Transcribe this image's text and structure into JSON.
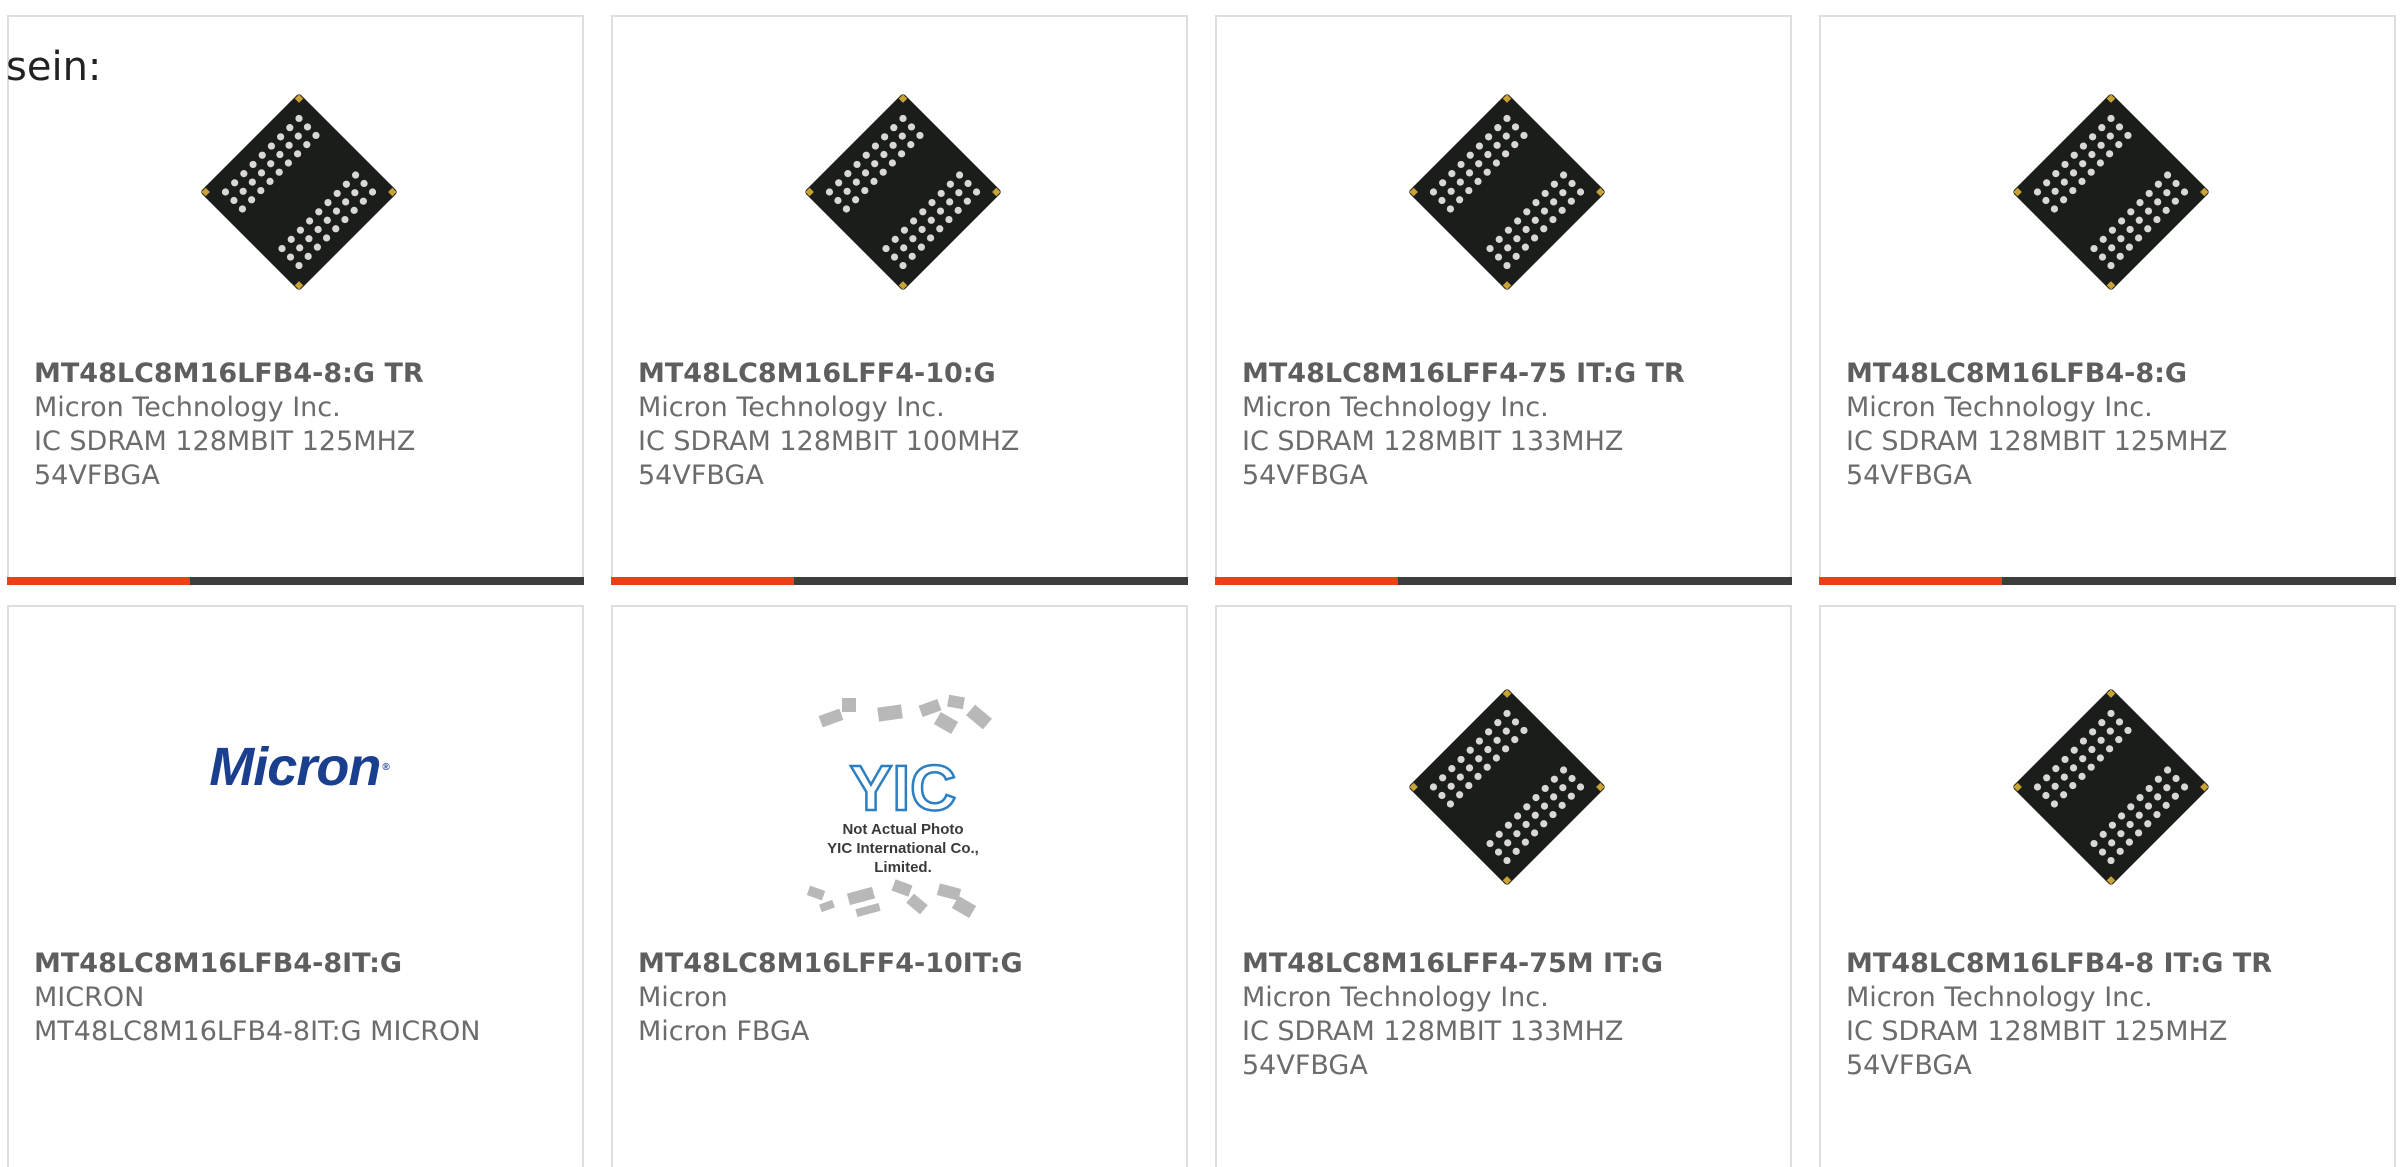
{
  "intro_text": "sein:",
  "colors": {
    "accent": "#e8411a",
    "bar_dark": "#3d3d3d",
    "micron_blue": "#1a3f8f",
    "yic_blue": "#2d7fc1"
  },
  "cards": [
    {
      "part_number": "MT48LC8M16LFB4-8:G TR",
      "manufacturer": "Micron Technology Inc.",
      "desc1": "IC SDRAM 128MBIT 125MHZ",
      "desc2": "54VFBGA",
      "image": "bga-chip-image"
    },
    {
      "part_number": "MT48LC8M16LFF4-10:G",
      "manufacturer": "Micron Technology Inc.",
      "desc1": "IC SDRAM 128MBIT 100MHZ",
      "desc2": "54VFBGA",
      "image": "bga-chip-image"
    },
    {
      "part_number": "MT48LC8M16LFF4-75 IT:G TR",
      "manufacturer": "Micron Technology Inc.",
      "desc1": "IC SDRAM 128MBIT 133MHZ",
      "desc2": "54VFBGA",
      "image": "bga-chip-image"
    },
    {
      "part_number": "MT48LC8M16LFB4-8:G",
      "manufacturer": "Micron Technology Inc.",
      "desc1": "IC SDRAM 128MBIT 125MHZ",
      "desc2": "54VFBGA",
      "image": "bga-chip-image"
    },
    {
      "part_number": "MT48LC8M16LFB4-8IT:G",
      "manufacturer": "MICRON",
      "desc1": "MT48LC8M16LFB4-8IT:G MICRON",
      "image": "micron-logo-image",
      "logo_text": "Micron"
    },
    {
      "part_number": "MT48LC8M16LFF4-10IT:G",
      "manufacturer": "Micron",
      "desc1": "Micron FBGA",
      "image": "placeholder-image",
      "placeholder_line1": "Not Actual Photo",
      "placeholder_line2": "YIC International Co., Limited.",
      "placeholder_logo": "YIC"
    },
    {
      "part_number": "MT48LC8M16LFF4-75M IT:G",
      "manufacturer": "Micron Technology Inc.",
      "desc1": "IC SDRAM 128MBIT 133MHZ",
      "desc2": "54VFBGA",
      "image": "bga-chip-image"
    },
    {
      "part_number": "MT48LC8M16LFB4-8 IT:G TR",
      "manufacturer": "Micron Technology Inc.",
      "desc1": "IC SDRAM 128MBIT 125MHZ",
      "desc2": "54VFBGA",
      "image": "bga-chip-image"
    }
  ]
}
